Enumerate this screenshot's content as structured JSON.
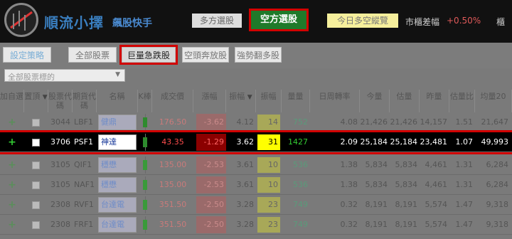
{
  "header": {
    "brand_name": "順流小擇",
    "brand_sub": "飆股快手",
    "btn_long": "多方選股",
    "btn_short": "空方選股",
    "btn_today": "今日多空縱覽",
    "spread_label": "市櫃差幅",
    "spread_value": "+0.50%",
    "right_cut": "櫃"
  },
  "strategy": {
    "setting": "設定策略",
    "all": "全部股票",
    "giant": "巨量急跌股",
    "short_release": "空頭奔放股",
    "strong_weak": "強勢翻多股"
  },
  "dropdown": {
    "value": "全部股票標的",
    "arrow": "▼"
  },
  "columns": [
    "加自選",
    "置頂",
    "股票代碼",
    "期貨代碼",
    "名稱",
    "K棒",
    "成交價",
    "漲幅",
    "振幅",
    "振幅",
    "量量",
    "日周轉率",
    "今量",
    "估量",
    "昨量",
    "估量比",
    "均量20"
  ],
  "rows": [
    {
      "plus": "+",
      "code": "3044",
      "fut": "LBF1",
      "name": "健鼎",
      "price": "176.50",
      "chg": "-3.62",
      "amp": "4.12",
      "amp2": "14",
      "vol": "752",
      "turnover": "4.08",
      "today": "21,426",
      "est": "21,426",
      "yday": "14,157",
      "ratio": "1.51",
      "avg20": "21,647"
    },
    {
      "plus": "+",
      "code": "3706",
      "fut": "PSF1",
      "name": "神達",
      "price": "43.35",
      "chg": "-1.29",
      "amp": "3.62",
      "amp2": "31",
      "vol": "1427",
      "turnover": "2.09",
      "today": "25,184",
      "est": "25,184",
      "yday": "23,481",
      "ratio": "1.07",
      "avg20": "49,993"
    },
    {
      "plus": "+",
      "code": "3105",
      "fut": "QIF1",
      "name": "穩懋(小...",
      "price": "135.00",
      "chg": "-2.53",
      "amp": "3.61",
      "amp2": "10",
      "vol": "536",
      "turnover": "1.38",
      "today": "5,834",
      "est": "5,834",
      "yday": "4,461",
      "ratio": "1.31",
      "avg20": "6,284"
    },
    {
      "plus": "+",
      "code": "3105",
      "fut": "NAF1",
      "name": "穩懋",
      "price": "135.00",
      "chg": "-2.53",
      "amp": "3.61",
      "amp2": "10",
      "vol": "536",
      "turnover": "1.38",
      "today": "5,834",
      "est": "5,834",
      "yday": "4,461",
      "ratio": "1.31",
      "avg20": "6,284"
    },
    {
      "plus": "+",
      "code": "2308",
      "fut": "RVF1",
      "name": "台達電(...",
      "price": "351.50",
      "chg": "-2.50",
      "amp": "3.28",
      "amp2": "23",
      "vol": "749",
      "turnover": "0.32",
      "today": "8,191",
      "est": "8,191",
      "yday": "5,574",
      "ratio": "1.47",
      "avg20": "9,318"
    },
    {
      "plus": "+",
      "code": "2308",
      "fut": "FRF1",
      "name": "台達電",
      "price": "351.50",
      "chg": "-2.50",
      "amp": "3.28",
      "amp2": "23",
      "vol": "749",
      "turnover": "0.32",
      "today": "8,191",
      "est": "8,191",
      "yday": "5,574",
      "ratio": "1.47",
      "avg20": "9,318"
    }
  ],
  "colors": {
    "selected_outline": "#d10000",
    "short_green": "#1f7a2a",
    "amp_highlight": "#ffff00"
  }
}
